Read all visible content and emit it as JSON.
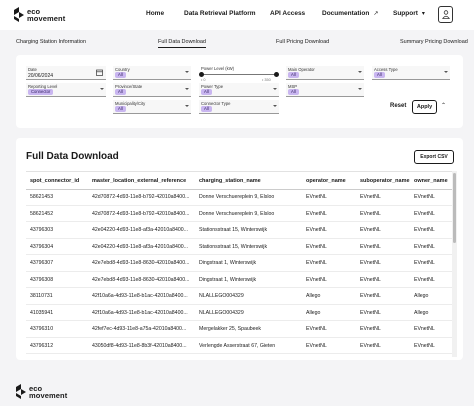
{
  "header": {
    "logo_line1": "eco",
    "logo_line2": "movement",
    "nav": [
      {
        "label": "Home"
      },
      {
        "label": "Data Retrieval Platform"
      },
      {
        "label": "API Access"
      },
      {
        "label": "Documentation",
        "icon": "external-link-icon"
      },
      {
        "label": "Support",
        "icon": "chevron-down-icon"
      }
    ],
    "user_icon": "user-icon"
  },
  "tabs": [
    {
      "label": "Charging Station Information",
      "active": false
    },
    {
      "label": "Full Data Download",
      "active": true
    },
    {
      "label": "Full Pricing Download",
      "active": false
    },
    {
      "label": "Summary Pricing Download",
      "active": false
    }
  ],
  "filters": {
    "date": {
      "label": "Date",
      "value": "20/06/2024",
      "icon": "calendar-icon"
    },
    "country": {
      "label": "Country",
      "value": "All"
    },
    "power_level": {
      "label": "Power Level (kW)",
      "min": "0",
      "max": "350",
      "range": [
        0,
        350
      ]
    },
    "main_operator": {
      "label": "Main Operator",
      "value": "All"
    },
    "access_type": {
      "label": "Access Type",
      "value": "All"
    },
    "reporting_level": {
      "label": "Reporting Level",
      "value": "Connector"
    },
    "province_state": {
      "label": "Province/State",
      "value": "All"
    },
    "power_type": {
      "label": "Power Type",
      "value": "All"
    },
    "msp": {
      "label": "MSP",
      "value": "All"
    },
    "municipality_city": {
      "label": "Municipality/City",
      "value": "All"
    },
    "connector_type": {
      "label": "Connector Type",
      "value": "All"
    },
    "reset_label": "Reset",
    "apply_label": "Apply",
    "collapse_icon": "chevron-up-icon"
  },
  "results": {
    "title": "Full Data Download",
    "export_label": "Export CSV",
    "columns": [
      "spot_connector_id",
      "master_location_external_reference",
      "charging_station_name",
      "operator_name",
      "suboperator_name",
      "owner_name"
    ],
    "rows": [
      [
        "58621453",
        "42d70872-4d93-11e8-b792-42010a8400...",
        "Donne Verschuereplein 9, Elsloo",
        "EVnetNL",
        "EVnetNL",
        "EVnetNL"
      ],
      [
        "58621452",
        "42d70872-4d93-11e8-b792-42010a8400...",
        "Donne Verschuereplein 9, Elsloo",
        "EVnetNL",
        "EVnetNL",
        "EVnetNL"
      ],
      [
        "43796303",
        "42e04220-4d93-11e8-af3a-42010a8400...",
        "Stationsstraat 15, Winterswijk",
        "EVnetNL",
        "EVnetNL",
        "EVnetNL"
      ],
      [
        "43796304",
        "42e04220-4d93-11e8-af3a-42010a8400...",
        "Stationsstraat 15, Winterswijk",
        "EVnetNL",
        "EVnetNL",
        "EVnetNL"
      ],
      [
        "43796307",
        "42e7ebd8-4d93-11e8-8630-42010a8400...",
        "Dingstraat 1, Winterswijk",
        "EVnetNL",
        "EVnetNL",
        "EVnetNL"
      ],
      [
        "43796308",
        "42e7ebd8-4d93-11e8-8630-42010a8400...",
        "Dingstraat 1, Winterswijk",
        "EVnetNL",
        "EVnetNL",
        "EVnetNL"
      ],
      [
        "38110731",
        "42f10a6a-4d93-11e8-b1ac-42010a8400...",
        "NLALLEGO004329",
        "Allego",
        "EVnetNL",
        "Allego"
      ],
      [
        "41035941",
        "42f10a6a-4d93-11e8-b1ac-42010a8400...",
        "NLALLEGO004329",
        "Allego",
        "EVnetNL",
        "Allego"
      ],
      [
        "43796310",
        "42fef7ec-4d93-11e8-a75a-42010a8400...",
        "Mergelakker 25, Spaubeek",
        "EVnetNL",
        "EVnetNL",
        "EVnetNL"
      ],
      [
        "43796312",
        "43050df8-4d93-11e8-8b3f-42010a8400...",
        "Verlengde Asserstraat 67, Gieten",
        "EVnetNL",
        "EVnetNL",
        "EVnetNL"
      ]
    ]
  },
  "footer": {
    "logo_line1": "eco",
    "logo_line2": "movement"
  }
}
